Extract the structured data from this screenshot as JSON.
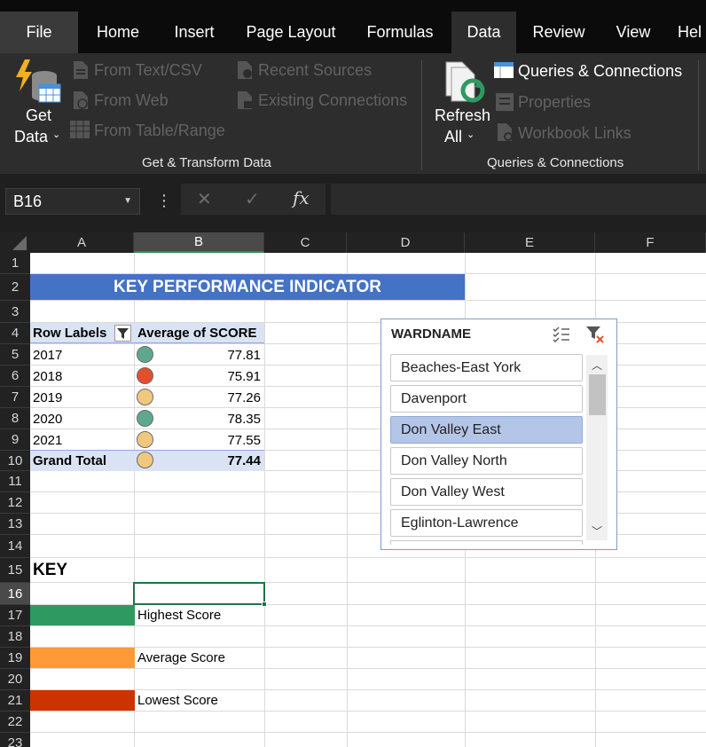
{
  "tabs": [
    "File",
    "Home",
    "Insert",
    "Page Layout",
    "Formulas",
    "Data",
    "Review",
    "View",
    "Hel"
  ],
  "active_tab": "Data",
  "ribbon": {
    "get_data_line1": "Get",
    "get_data_line2": "Data",
    "from_text_csv": "From Text/CSV",
    "from_web": "From Web",
    "from_table_range": "From Table/Range",
    "recent_sources": "Recent Sources",
    "existing_connections": "Existing Connections",
    "group1_label": "Get & Transform Data",
    "refresh_line1": "Refresh",
    "refresh_line2": "All",
    "queries_connections": "Queries & Connections",
    "properties": "Properties",
    "workbook_links": "Workbook Links",
    "group2_label": "Queries & Connections"
  },
  "formula_bar": {
    "name_box": "B16",
    "more_icon": "⋮",
    "cancel_icon": "✕",
    "enter_icon": "✓",
    "fx_label": "fx",
    "formula": ""
  },
  "columns": [
    "A",
    "B",
    "C",
    "D",
    "E",
    "F"
  ],
  "selected_column": "B",
  "rows": [
    "1",
    "2",
    "3",
    "4",
    "5",
    "6",
    "7",
    "8",
    "9",
    "10",
    "11",
    "12",
    "13",
    "14",
    "15",
    "16",
    "17",
    "18",
    "19",
    "20",
    "21",
    "22",
    "23"
  ],
  "selected_row": "16",
  "banner": "KEY PERFORMANCE INDICATOR",
  "pivot": {
    "header_labels": "Row Labels",
    "header_values": "Average of SCORE",
    "rows": [
      {
        "label": "2017",
        "value": "77.81",
        "status": "green"
      },
      {
        "label": "2018",
        "value": "75.91",
        "status": "red"
      },
      {
        "label": "2019",
        "value": "77.26",
        "status": "yellow"
      },
      {
        "label": "2020",
        "value": "78.35",
        "status": "green"
      },
      {
        "label": "2021",
        "value": "77.55",
        "status": "yellow"
      }
    ],
    "total_label": "Grand Total",
    "total_value": "77.44",
    "total_status": "yellow"
  },
  "status_colors": {
    "green": "#5ea891",
    "red": "#e2502b",
    "yellow": "#f0c77c"
  },
  "key": {
    "title": "KEY",
    "items": [
      {
        "label": "Highest Score",
        "color": "#2e9a61"
      },
      {
        "label": "Average Score",
        "color": "#ff9a36"
      },
      {
        "label": "Lowest Score",
        "color": "#cc3300"
      }
    ]
  },
  "slicer": {
    "title": "WARDNAME",
    "multiselect_icon": "multi-select-icon",
    "clear_filter_icon": "clear-filter-icon",
    "items": [
      "Beaches-East York",
      "Davenport",
      "Don Valley East",
      "Don Valley North",
      "Don Valley West",
      "Eglinton-Lawrence"
    ],
    "selected": "Don Valley East"
  },
  "accent_color": "#217346"
}
